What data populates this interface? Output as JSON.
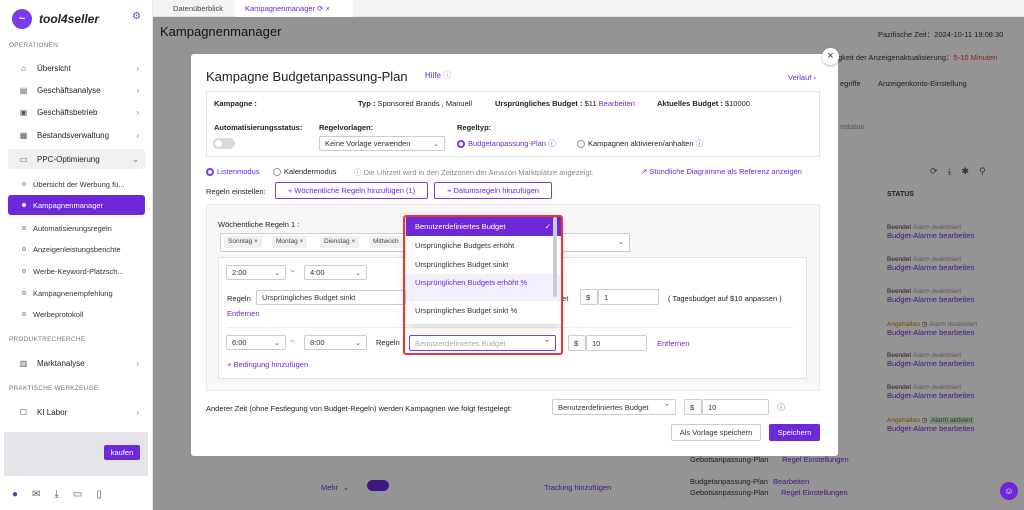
{
  "app": {
    "name": "tool4seller"
  },
  "sidebar": {
    "sec_operations": "OPERATIONEN",
    "sec_product": "PRODUKTRECHERCHE",
    "sec_tools": "PRAKTISCHE WERKZEUGE",
    "items": [
      "Übersicht",
      "Geschäftsanalyse",
      "Geschäftsbetrieb",
      "Bestandsverwaltung",
      "PPC-Optimierung"
    ],
    "ppc_sub": [
      "Übersicht der Werbung fü...",
      "Kampagnenmanager",
      "Automatisierungsregeln",
      "Anzeigenleistungsberichte",
      "Werbe-Keyword-Platzsch...",
      "Kampagnenempfehlung",
      "Werbeprotokoll"
    ],
    "market": "Marktanalyse",
    "ai": "KI Labor",
    "buy": "kaufen"
  },
  "tabs": [
    "Datenüberblick",
    "Kampagnenmanager"
  ],
  "page": {
    "title": "Kampagnenmanager",
    "time": "Pazifische Zeit：2024-10-11 19:08:30",
    "update": "gkeit der Anzeigenaktualisierung：",
    "update_val": "5-10 Minuten",
    "col_status": "STATUS",
    "tab_rules": "egriffe",
    "tab_account": "Anzeigenkonto-Einstellung",
    "nstatus": "nstatus",
    "bg_left": [
      "Beendet",
      "Budget-Alarme bearbeiten",
      "Beendet",
      "Budget-Alarme bearbeiten",
      "Beendet",
      "Budget-Alarme bearbeiten",
      "Angehalten",
      "Budget-Alarme bearbeiten",
      "Beendet",
      "Budget-Alarme bearbeiten",
      "Beendet",
      "Budget-Alarme bearbeiten",
      "Angehalten",
      "Budget-Alarme bearbeiten"
    ],
    "alarm_off": "Alarm deaktiviert",
    "alarm_on": "Alarm aktiviert",
    "row_more": "Mehr",
    "tracking": "Tracking hinzufügen",
    "gebot_plan": "Gebotsanpassung-Plan",
    "regel_einst": "Regel Einstellungen",
    "budget_plan": "Budgetanpassung-Plan",
    "bearbeiten": "Bearbeiten",
    "bg_links": [
      "gen",
      "gen",
      "gen",
      "ten",
      "gen",
      "gen",
      "gen",
      "gen",
      "ten",
      "ten"
    ]
  },
  "modal": {
    "title": "Kampagne Budgetanpassung-Plan",
    "help": "Hilfe",
    "history": "Verlauf",
    "campaign_label": "Kampagne :",
    "type_label": "Typ : ",
    "type_val": "Sponsored Brands , Manuell",
    "orig_budget_label": "Ursprüngliches Budget : ",
    "orig_budget_val": "$11",
    "edit": "Bearbeiten",
    "curr_budget_label": "Aktuelles Budget : ",
    "curr_budget_val": "$10000",
    "auto_status": "Automatisierungsstatus:",
    "templates_label": "Regelvorlagen:",
    "template_val": "Keine Vorlage verwenden",
    "rule_type_label": "Regeltyp:",
    "rule_type_1": "Budgetanpassung-Plan",
    "rule_type_2": "Kampagnen aktivieren/anhalten",
    "mode_list": "Listenmodus",
    "mode_cal": "Kalendermodus",
    "tz_note": "Die Uhrzeit wird in den Zeitzonen der Amazon Marktplätze angezeigt.",
    "hourly_link": "Stündliche Diagramme als Referenz anzeigen",
    "set_rules": "Regeln einstellen:",
    "add_weekly": "+ Wöchentliche Regeln hinzufügen (1)",
    "add_date": "+ Datumsregeln hinzufügen",
    "weekly_title": "Wöchentliche Regeln 1 :",
    "days": [
      "Sonntag",
      "Montag",
      "Dienstag",
      "Mittwoch"
    ],
    "slot1_from": "2:00",
    "slot1_to": "4:00",
    "rules_label": "Regeln",
    "slot1_rule": "Ursprüngliches Budget sinkt",
    "slot1_currency": "$",
    "slot1_val": "1",
    "slot1_hint": "( Tagesbudget auf $10 anpassen )",
    "remove": "Entfernen",
    "slot2_from": "6:00",
    "slot2_to": "8:00",
    "slot2_placeholder": "Benutzerdefiniertes Budget",
    "slot2_currency": "$",
    "slot2_val": "10",
    "add_condition": "+ Bedingung hinzufügen",
    "other_time": "Anderer Zeit (ohne Festlegung von Budget-Regeln) werden Kampagnen wie folgt festgelegt:",
    "other_sel": "Benutzerdefiniertes Budget",
    "other_currency": "$",
    "other_val": "10",
    "save_template": "Als Vorlage speichern",
    "save": "Speichern",
    "dropdown": [
      "Benutzerdefiniertes Budget",
      "Ursprüngliche Budgets erhöht",
      "Ursprüngliches Budget sinkt",
      "Ursprünglichen Budgets erhöht %",
      "Ursprüngliches Budget sinkt %"
    ],
    "close": "×"
  },
  "colors": {
    "accent": "#6d28d9",
    "danger": "#e53935",
    "overlay": "rgba(0,0,0,0.42)"
  }
}
